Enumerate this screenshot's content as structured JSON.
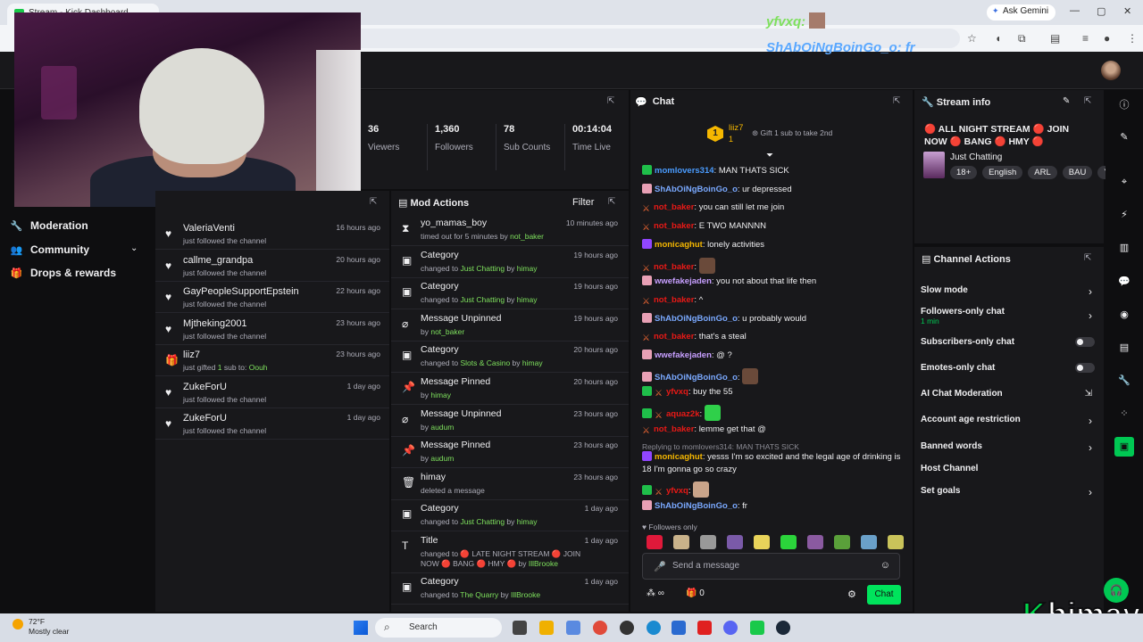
{
  "browser": {
    "tab_title": "Stream - Kick Dashboard",
    "ask_gemini": "Ask Gemini"
  },
  "sidebar": {
    "items": [
      {
        "label": "Moderation",
        "icon": "wrench-icon"
      },
      {
        "label": "Community",
        "icon": "people-icon"
      },
      {
        "label": "Drops & rewards",
        "icon": "gift-icon"
      }
    ]
  },
  "stats": [
    {
      "value": "36",
      "label": "Viewers"
    },
    {
      "value": "1,360",
      "label": "Followers"
    },
    {
      "value": "78",
      "label": "Sub Counts"
    },
    {
      "value": "00:14:04",
      "label": "Time Live"
    }
  ],
  "activity": [
    {
      "name": "ValeriaVenti",
      "desc": "just followed the channel",
      "time": "16 hours ago",
      "icon": "heart-icon"
    },
    {
      "name": "callme_grandpa",
      "desc": "just followed the channel",
      "time": "20 hours ago",
      "icon": "heart-icon"
    },
    {
      "name": "GayPeopleSupportEpstein",
      "desc": "just followed the channel",
      "time": "22 hours ago",
      "icon": "heart-icon"
    },
    {
      "name": "Mjtheking2001",
      "desc": "just followed the channel",
      "time": "23 hours ago",
      "icon": "heart-icon"
    },
    {
      "name": "liiz7",
      "desc_pre": "just gifted ",
      "desc_hl": "1",
      "desc_mid": " sub to: ",
      "desc_hl2": "Oouh",
      "time": "23 hours ago",
      "icon": "gift-icon"
    },
    {
      "name": "ZukeForU",
      "desc": "just followed the channel",
      "time": "1 day ago",
      "icon": "heart-icon"
    },
    {
      "name": "ZukeForU",
      "desc": "just followed the channel",
      "time": "1 day ago",
      "icon": "heart-icon"
    }
  ],
  "mod": {
    "title": "Mod Actions",
    "filter": "Filter",
    "rows": [
      {
        "action": "yo_mamas_boy",
        "pre": "timed out for 5 minutes by ",
        "hl": "not_baker",
        "time": "10 minutes ago",
        "icon": "hourglass-icon"
      },
      {
        "action": "Category",
        "pre": "changed to ",
        "hl": "Just Chatting",
        "mid": " by ",
        "hl2": "himay",
        "time": "19 hours ago",
        "icon": "category-icon"
      },
      {
        "action": "Category",
        "pre": "changed to ",
        "hl": "Just Chatting",
        "mid": " by ",
        "hl2": "himay",
        "time": "19 hours ago",
        "icon": "category-icon"
      },
      {
        "action": "Message Unpinned",
        "pre": "by ",
        "hl": "not_baker",
        "time": "19 hours ago",
        "icon": "unpin-icon"
      },
      {
        "action": "Category",
        "pre": "changed to ",
        "hl": "Slots & Casino",
        "mid": " by ",
        "hl2": "himay",
        "time": "20 hours ago",
        "icon": "category-icon"
      },
      {
        "action": "Message Pinned",
        "pre": "by ",
        "hl": "himay",
        "time": "20 hours ago",
        "icon": "pin-icon"
      },
      {
        "action": "Message Unpinned",
        "pre": "by ",
        "hl": "audum",
        "time": "23 hours ago",
        "icon": "unpin-icon"
      },
      {
        "action": "Message Pinned",
        "pre": "by ",
        "hl": "audum",
        "time": "23 hours ago",
        "icon": "pin-icon"
      },
      {
        "action": "himay",
        "pre": "deleted a message",
        "time": "23 hours ago",
        "icon": "trash-icon"
      },
      {
        "action": "Category",
        "pre": "changed to ",
        "hl": "Just Chatting",
        "mid": " by ",
        "hl2": "himay",
        "time": "1 day ago",
        "icon": "category-icon"
      },
      {
        "action": "Title",
        "pre": "changed to 🔴 LATE NIGHT STREAM 🔴 JOIN NOW 🔴 BANG 🔴 HMY 🔴 by ",
        "hl": "IllBrooke",
        "time": "1 day ago",
        "icon": "title-icon"
      },
      {
        "action": "Category",
        "pre": "changed to ",
        "hl": "The Quarry",
        "mid": " by ",
        "hl2": "IllBrooke",
        "time": "1 day ago",
        "icon": "category-icon"
      }
    ]
  },
  "chat": {
    "title": "Chat",
    "gift_user": "liiz7",
    "gift_count": "1",
    "gift_rank": "1",
    "gift_cta": "Gift 1 sub to take 2nd",
    "messages": [
      {
        "user": "momlovers314",
        "color": "#4a9cff",
        "badges": [
          "gr"
        ],
        "text": "MAN THATS SICK"
      },
      {
        "user": "ShAbOiNgBoinGo_o",
        "color": "#7aa9ff",
        "badges": [
          "pk"
        ],
        "text": "ur depressed"
      },
      {
        "user": "not_baker",
        "color": "#e91916",
        "badges": [
          "mod",
          "sw"
        ],
        "text": "you can still let me join"
      },
      {
        "user": "not_baker",
        "color": "#e91916",
        "badges": [
          "mod",
          "sw"
        ],
        "text": "E TWO MANNNN"
      },
      {
        "user": "monicaghut",
        "color": "#f5b700",
        "badges": [
          "pu"
        ],
        "text": "lonely activities"
      },
      {
        "user": "not_baker",
        "color": "#e91916",
        "badges": [
          "mod",
          "sw"
        ],
        "text": ""
      },
      {
        "user": "wwefakejaden",
        "color": "#c79fff",
        "badges": [
          "pk"
        ],
        "text": "you not about that life then"
      },
      {
        "user": "not_baker",
        "color": "#e91916",
        "badges": [
          "mod",
          "sw"
        ],
        "text": "^"
      },
      {
        "user": "ShAbOiNgBoinGo_o",
        "color": "#7aa9ff",
        "badges": [
          "pk"
        ],
        "text": "u probably would"
      },
      {
        "user": "not_baker",
        "color": "#e91916",
        "badges": [
          "mod",
          "sw"
        ],
        "text": "that's a steal"
      },
      {
        "user": "wwefakejaden",
        "color": "#c79fff",
        "badges": [
          "pk"
        ],
        "text": "@ ?"
      },
      {
        "user": "ShAbOiNgBoinGo_o",
        "color": "#7aa9ff",
        "badges": [
          "pk"
        ],
        "text": ""
      },
      {
        "user": "yfvxq",
        "color": "#e91916",
        "badges": [
          "gr",
          "sw"
        ],
        "text": "buy the 55"
      },
      {
        "user": "aquaz2k",
        "color": "#e91916",
        "badges": [
          "gr",
          "sw"
        ],
        "text": ""
      },
      {
        "user": "not_baker",
        "color": "#e91916",
        "badges": [
          "mod",
          "sw"
        ],
        "text": "lemme get that @"
      }
    ],
    "reply_to": "Replying to momlovers314: MAN THATS SICK",
    "reply_msg": {
      "user": "monicaghut",
      "text": "yesss I'm so excited and the legal age of drinking is 18 I'm gonna go so crazy"
    },
    "after": [
      {
        "user": "yfvxq",
        "text": ""
      },
      {
        "user": "ShAbOiNgBoinGo_o",
        "text": "fr"
      }
    ],
    "followers_only": "Followers only",
    "placeholder": "Send a message",
    "points": "∞",
    "gifts": "0",
    "send": "Chat"
  },
  "stream_info": {
    "title": "Stream info",
    "stream_title_a": "ALL NIGHT STREAM",
    "stream_title_b": "JOIN NOW",
    "stream_title_c": "BANG",
    "stream_title_d": "HMY",
    "category": "Just Chatting",
    "tags": [
      "18+",
      "English",
      "ARL",
      "BAU",
      "Y"
    ]
  },
  "channel_actions": {
    "title": "Channel Actions",
    "rows": [
      {
        "label": "Slow mode",
        "control": "arrow"
      },
      {
        "label": "Followers-only chat",
        "sub": "1 min",
        "control": "arrow"
      },
      {
        "label": "Subscribers-only chat",
        "control": "toggle"
      },
      {
        "label": "Emotes-only chat",
        "control": "toggle"
      },
      {
        "label": "AI Chat Moderation",
        "control": "external"
      },
      {
        "label": "Account age restriction",
        "control": "arrow"
      },
      {
        "label": "Banned words",
        "control": "arrow"
      },
      {
        "label": "Host Channel",
        "control": "none"
      },
      {
        "label": "Set goals",
        "control": "arrow"
      }
    ]
  },
  "overlay": {
    "line1": "yfvxq:",
    "line2": "ShAbOiNgBoinGo_o: fr",
    "brand": "himay"
  },
  "taskbar": {
    "temp": "72°F",
    "weather": "Mostly clear",
    "search": "Search"
  }
}
